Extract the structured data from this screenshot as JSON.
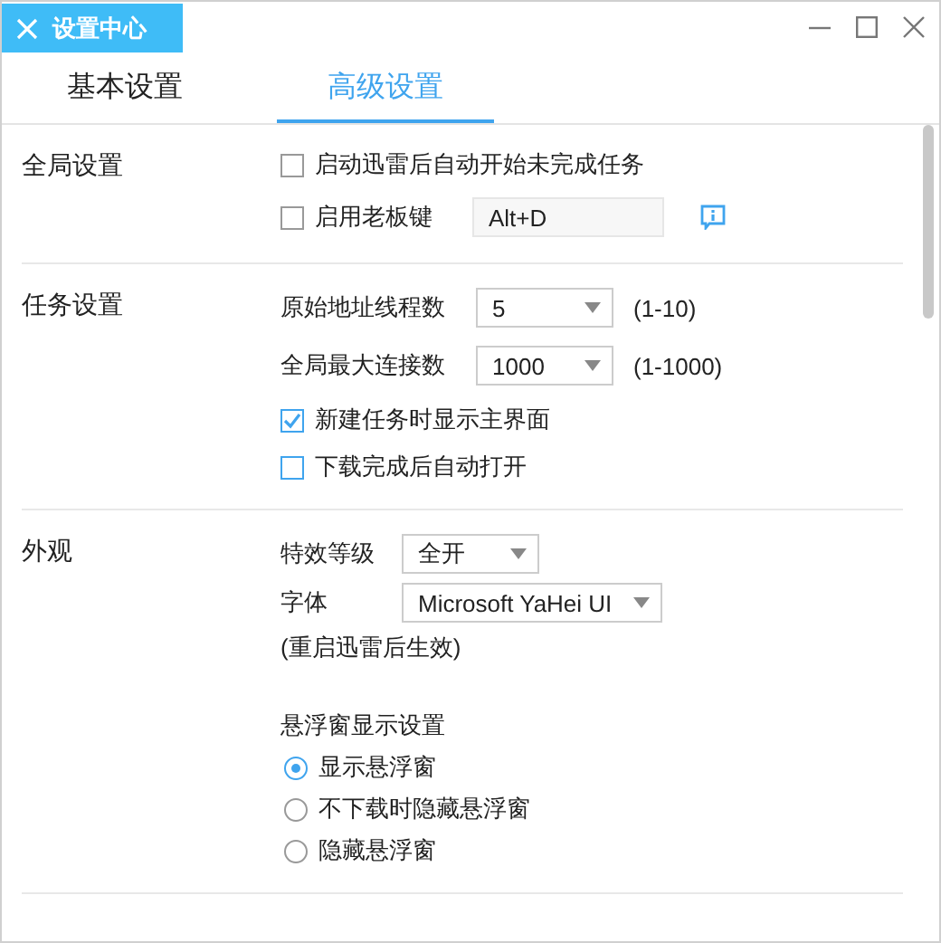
{
  "window": {
    "title": "设置中心"
  },
  "tabs": [
    {
      "label": "基本设置",
      "selected": false
    },
    {
      "label": "高级设置",
      "selected": true
    }
  ],
  "sections": [
    {
      "title": "全局设置",
      "items": [
        {
          "kind": "checkbox",
          "label": "启动迅雷后自动开始未完成任务",
          "checked": false
        },
        {
          "kind": "hotkey",
          "label": "启用老板键",
          "checked": false,
          "value": "Alt+D"
        }
      ]
    },
    {
      "title": "任务设置",
      "items": [
        {
          "kind": "select",
          "label": "原始地址线程数",
          "value": "5",
          "range": "(1-10)"
        },
        {
          "kind": "select",
          "label": "全局最大连接数",
          "value": "1000",
          "range": "(1-1000)"
        },
        {
          "kind": "checkbox",
          "label": "新建任务时显示主界面",
          "checked": true
        },
        {
          "kind": "checkbox",
          "label": "下载完成后自动打开",
          "checked": false
        }
      ]
    },
    {
      "title": "外观",
      "items": [
        {
          "kind": "select",
          "label": "特效等级",
          "value": "全开"
        },
        {
          "kind": "select",
          "label": "字体",
          "value": "Microsoft YaHei UI"
        },
        {
          "kind": "note",
          "label": "(重启迅雷后生效)"
        },
        {
          "kind": "heading",
          "label": "悬浮窗显示设置"
        },
        {
          "kind": "radio",
          "label": "显示悬浮窗",
          "selected": true
        },
        {
          "kind": "radio",
          "label": "不下载时隐藏悬浮窗",
          "selected": false
        },
        {
          "kind": "radio",
          "label": "隐藏悬浮窗",
          "selected": false
        }
      ]
    }
  ]
}
